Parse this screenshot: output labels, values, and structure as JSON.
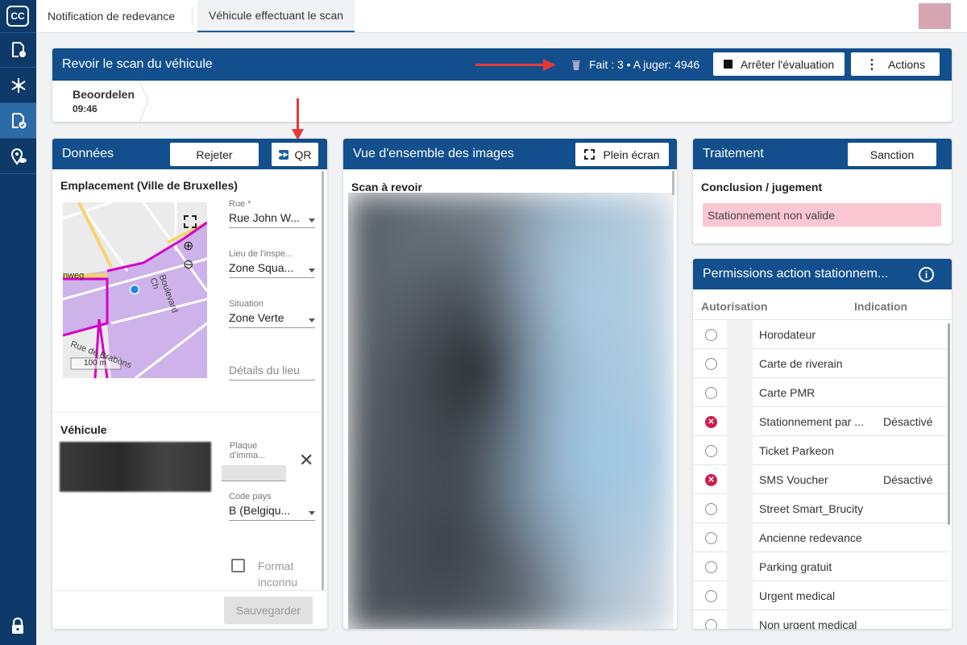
{
  "app": {
    "logo": "CC"
  },
  "tabs": [
    {
      "label": "Notification de redevance"
    },
    {
      "label": "Véhicule effectuant le scan"
    }
  ],
  "review": {
    "title": "Revoir le scan du véhicule",
    "stats_icon": "trash-icon",
    "stats": "Fait : 3 • A juger: 4946",
    "stop_label": "Arrêter l'évaluation",
    "actions_label": "Actions",
    "step_name": "Beoordelen",
    "step_time": "09:46"
  },
  "donnees": {
    "title": "Données",
    "reject_label": "Rejeter",
    "qr_label": "QR",
    "location_title": "Emplacement (Ville de Bruxelles)",
    "map_labels": {
      "street1": "nweg",
      "street2": "Boulevard Ch",
      "street3": "Rue de Brabons",
      "scale": "100 m"
    },
    "street_label": "Rue *",
    "street_value": "Rue John W...",
    "inspection_label": "Lieu de l'inspe...",
    "inspection_value": "Zone Squa...",
    "situation_label": "Situation",
    "situation_value": "Zone Verte",
    "details_placeholder": "Détails du lieu",
    "vehicle_title": "Véhicule",
    "plate_label": "Plaque d'imma...",
    "country_label": "Code pays",
    "country_value": "B (Belgiqu...",
    "unknown_format_label": "Format inconnu",
    "save_label": "Sauvegarder"
  },
  "images": {
    "title": "Vue d'ensemble des images",
    "fullscreen_label": "Plein écran",
    "scan_label": "Scan à revoir"
  },
  "traitement": {
    "title": "Traitement",
    "sanction_label": "Sanction",
    "conclusion_label": "Conclusion / jugement",
    "conclusion_value": "Stationnement non valide"
  },
  "permissions": {
    "title": "Permissions action stationnem...",
    "col_auth": "Autorisation",
    "col_ind": "Indication",
    "rows": [
      {
        "name": "Horodateur",
        "indication": "",
        "status": "empty"
      },
      {
        "name": "Carte de riverain",
        "indication": "",
        "status": "empty"
      },
      {
        "name": "Carte PMR",
        "indication": "",
        "status": "empty"
      },
      {
        "name": "Stationnement par ...",
        "indication": "Désactivé",
        "status": "error"
      },
      {
        "name": "Ticket Parkeon",
        "indication": "",
        "status": "empty"
      },
      {
        "name": "SMS Voucher",
        "indication": "Désactivé",
        "status": "error"
      },
      {
        "name": "Street Smart_Brucity",
        "indication": "",
        "status": "empty"
      },
      {
        "name": "Ancienne redevance",
        "indication": "",
        "status": "empty"
      },
      {
        "name": "Parking gratuit",
        "indication": "",
        "status": "empty"
      },
      {
        "name": "Urgent medical",
        "indication": "",
        "status": "empty"
      },
      {
        "name": "Non urgent medical",
        "indication": "",
        "status": "empty"
      }
    ]
  },
  "colors": {
    "primary": "#124f8c",
    "sidebar": "#0e3a6a",
    "error": "#d01e4c",
    "invalid_bg": "#fbc7d2"
  }
}
